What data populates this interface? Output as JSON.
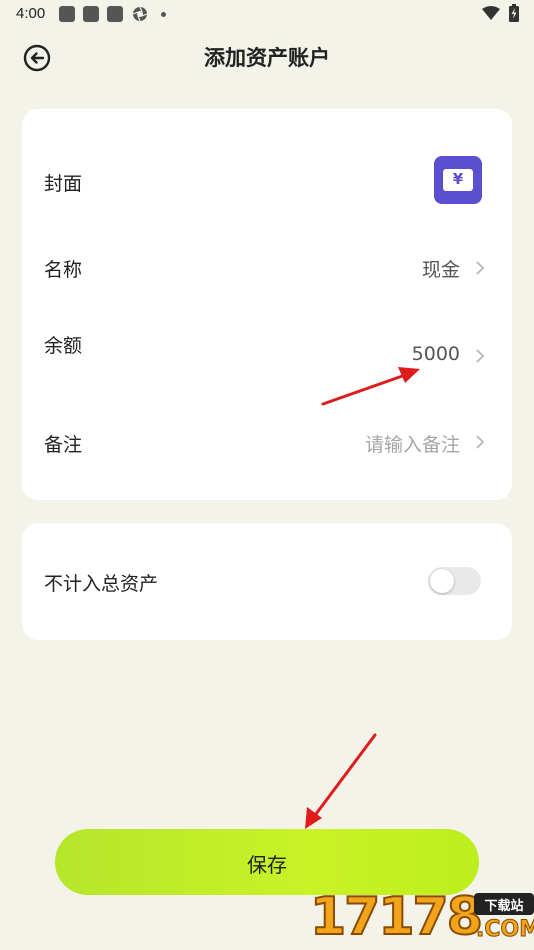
{
  "status_bar": {
    "time": "4:00"
  },
  "header": {
    "title": "添加资产账户",
    "back_icon": "back-arrow-circle-icon"
  },
  "form": {
    "cover": {
      "label": "封面",
      "icon": "wallet-yen-icon",
      "icon_symbol": "¥",
      "icon_color": "#5a4fcf"
    },
    "name": {
      "label": "名称",
      "value": "现金"
    },
    "balance": {
      "label": "余额",
      "value": "5000"
    },
    "note": {
      "label": "备注",
      "placeholder": "请输入备注"
    }
  },
  "exclude": {
    "label": "不计入总资产",
    "enabled": false
  },
  "save_button": {
    "label": "保存",
    "color": "#c4f024"
  },
  "watermark": {
    "digits": "17178",
    "tag": "下载站",
    "domain": ".COM"
  }
}
